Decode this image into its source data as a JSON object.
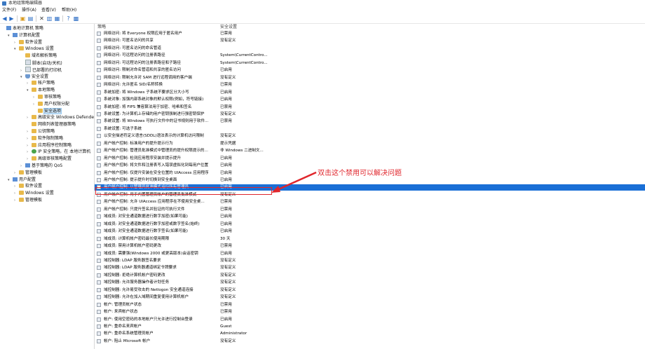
{
  "window": {
    "title": "本地组策略编辑器"
  },
  "menu": [
    "文件(F)",
    "操作(A)",
    "查看(V)",
    "帮助(H)"
  ],
  "toolbar": [
    "back-icon",
    "forward-icon",
    "folder-up-icon",
    "properties-icon",
    "delete-icon",
    "export-icon",
    "help-icon",
    "view-icon"
  ],
  "tree": [
    {
      "label": "本地计算机 策略",
      "indent": 0,
      "arrow": "",
      "icon": "pc"
    },
    {
      "label": "计算机配置",
      "indent": 1,
      "arrow": "▾",
      "icon": "pc"
    },
    {
      "label": "软件设置",
      "indent": 2,
      "arrow": "›",
      "icon": "folder"
    },
    {
      "label": "Windows 设置",
      "indent": 2,
      "arrow": "▾",
      "icon": "folder"
    },
    {
      "label": "域名解析策略",
      "indent": 3,
      "arrow": "",
      "icon": "folder"
    },
    {
      "label": "脚本(启动/关机)",
      "indent": 3,
      "arrow": "",
      "icon": "doc"
    },
    {
      "label": "已部署的打印机",
      "indent": 3,
      "arrow": "›",
      "icon": "doc"
    },
    {
      "label": "安全设置",
      "indent": 3,
      "arrow": "▾",
      "icon": "shield"
    },
    {
      "label": "帐户策略",
      "indent": 4,
      "arrow": "›",
      "icon": "folder"
    },
    {
      "label": "本地策略",
      "indent": 4,
      "arrow": "▾",
      "icon": "folder"
    },
    {
      "label": "审核策略",
      "indent": 5,
      "arrow": "›",
      "icon": "folder"
    },
    {
      "label": "用户权限分配",
      "indent": 5,
      "arrow": "›",
      "icon": "folder"
    },
    {
      "label": "安全选项",
      "indent": 5,
      "arrow": "",
      "icon": "folder",
      "selected": true
    },
    {
      "label": "高级安全 Windows Defender 防火墙",
      "indent": 4,
      "arrow": "›",
      "icon": "folder"
    },
    {
      "label": "网络列表管理器策略",
      "indent": 4,
      "arrow": "",
      "icon": "folder"
    },
    {
      "label": "公钥策略",
      "indent": 4,
      "arrow": "›",
      "icon": "folder"
    },
    {
      "label": "软件限制策略",
      "indent": 4,
      "arrow": "›",
      "icon": "folder"
    },
    {
      "label": "应用程序控制策略",
      "indent": 4,
      "arrow": "›",
      "icon": "folder"
    },
    {
      "label": "IP 安全策略，在 本地计算机",
      "indent": 4,
      "arrow": "›",
      "icon": "net"
    },
    {
      "label": "高级审核策略配置",
      "indent": 4,
      "arrow": "›",
      "icon": "folder"
    },
    {
      "label": "基于策略的 QoS",
      "indent": 3,
      "arrow": "›",
      "icon": "pc"
    },
    {
      "label": "管理模板",
      "indent": 2,
      "arrow": "›",
      "icon": "folder"
    },
    {
      "label": "用户配置",
      "indent": 1,
      "arrow": "▾",
      "icon": "pc"
    },
    {
      "label": "软件设置",
      "indent": 2,
      "arrow": "›",
      "icon": "folder"
    },
    {
      "label": "Windows 设置",
      "indent": 2,
      "arrow": "›",
      "icon": "folder"
    },
    {
      "label": "管理模板",
      "indent": 2,
      "arrow": "›",
      "icon": "folder"
    }
  ],
  "columns": {
    "policy": "策略",
    "setting": "安全设置"
  },
  "policies": [
    {
      "name": "网络访问: 将 Everyone 权限应用于匿名用户",
      "value": "已禁用"
    },
    {
      "name": "网络访问: 可匿名访问的共享",
      "value": "没有定义"
    },
    {
      "name": "网络访问: 可匿名访问的命名管道",
      "value": ""
    },
    {
      "name": "网络访问: 可远程访问的注册表路径",
      "value": "System\\CurrentContro..."
    },
    {
      "name": "网络访问: 可远程访问的注册表路径和子路径",
      "value": "System\\CurrentContro..."
    },
    {
      "name": "网络访问: 限制对命名管道和共享的匿名访问",
      "value": "已启用"
    },
    {
      "name": "网络访问: 限制允许对 SAM 进行远程调用的客户端",
      "value": "没有定义"
    },
    {
      "name": "网络访问: 允许匿名 SID/名称转换",
      "value": "已禁用"
    },
    {
      "name": "系统加密: 将 Windows 子系统不要求区分大小写",
      "value": "已启用"
    },
    {
      "name": "系统对象: 加强内部系统对象的默认权限(例如，符号链接)",
      "value": "已启用"
    },
    {
      "name": "系统加密: 将 FIPS 兼容算法用于加密、哈希和签名",
      "value": "已禁用"
    },
    {
      "name": "系统设置: 为计算机上存储的用户密钥强制进行强密钥保护",
      "value": "没有定义"
    },
    {
      "name": "系统设置: 将 Windows 可执行文件中的证书规则用于软件...",
      "value": "已禁用"
    },
    {
      "name": "系统设置: 可选子系统",
      "value": ""
    },
    {
      "name": "以安全描述符定义语言(SDDL)语法表示的计算机访问限制",
      "value": "没有定义"
    },
    {
      "name": "用户帐户控制: 标准用户的提升提示行为",
      "value": "提示凭据"
    },
    {
      "name": "用户帐户控制: 管理员批准模式中管理员的提升权限提示的...",
      "value": "非 Windows 二进制文..."
    },
    {
      "name": "用户帐户控制: 检测应用程序安装并提示提升",
      "value": "已启用"
    },
    {
      "name": "用户帐户控制: 将文件和注册表写入错误虚拟化到每用户位置",
      "value": "已启用"
    },
    {
      "name": "用户帐户控制: 仅提升安装在安全位置的 UIAccess 应用程序",
      "value": "已启用"
    },
    {
      "name": "用户帐户控制: 提示提升时切换到安全桌面",
      "value": "已启用"
    },
    {
      "name": "用户帐户控制: 以管理员批准模式运行所有管理员",
      "value": "已启用",
      "highlight": true
    },
    {
      "name": "用户帐户控制: 用于内置管理员帐户的管理员批准模式",
      "value": "没有定义"
    },
    {
      "name": "用户帐户控制: 允许 UIAccess 应用程序在不使用安全桌...",
      "value": "已禁用"
    },
    {
      "name": "用户帐户控制: 只提升签名并验证的可执行文件",
      "value": "已禁用"
    },
    {
      "name": "域成员: 对安全通道数据进行数字加密(如果可能)",
      "value": "已启用"
    },
    {
      "name": "域成员: 对安全通道数据进行数字加密或数字签名(始终)",
      "value": "已启用"
    },
    {
      "name": "域成员: 对安全通道数据进行数字签名(如果可能)",
      "value": "已启用"
    },
    {
      "name": "域成员: 计算机帐户密码最长使用期限",
      "value": "30 天"
    },
    {
      "name": "域成员: 禁用计算机帐户密码更改",
      "value": "已禁用"
    },
    {
      "name": "域成员: 需要强(Windows 2000 或更高版本)会话密钥",
      "value": "已启用"
    },
    {
      "name": "域控制器: LDAP 服务器签名要求",
      "value": "没有定义"
    },
    {
      "name": "域控制器: LDAP 服务器通道绑定令牌要求",
      "value": "没有定义"
    },
    {
      "name": "域控制器: 拒绝计算机帐户密码更改",
      "value": "没有定义"
    },
    {
      "name": "域控制器: 允许服务器操作者计划任务",
      "value": "没有定义"
    },
    {
      "name": "域控制器: 允许易受攻击的 Netlogon 安全通道连接",
      "value": "没有定义"
    },
    {
      "name": "域控制器: 允许在加入域期间重复使用计算机帐户",
      "value": "没有定义"
    },
    {
      "name": "帐户: 管理员帐户状态",
      "value": "已禁用"
    },
    {
      "name": "帐户: 来宾帐户状态",
      "value": "已禁用"
    },
    {
      "name": "帐户: 使用空密码的本地帐户只允许进行控制台登录",
      "value": "已启用"
    },
    {
      "name": "帐户: 重命名来宾帐户",
      "value": "Guest"
    },
    {
      "name": "帐户: 重命名系统管理员帐户",
      "value": "Administrator"
    },
    {
      "name": "帐户: 阻止 Microsoft 帐户",
      "value": "没有定义"
    }
  ],
  "annotation": {
    "text": "双击这个禁用可以解决问题",
    "color": "#e0262c"
  }
}
